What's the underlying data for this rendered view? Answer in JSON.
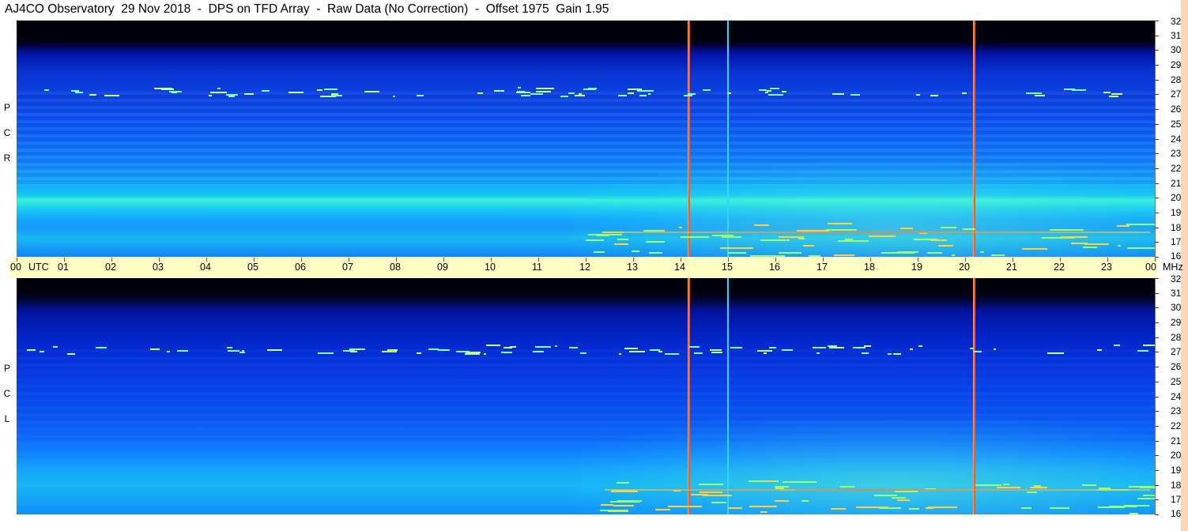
{
  "title": "AJ4CO Observatory  29 Nov 2018  -  DPS on TFD Array  -  Raw Data (No Correction)  -  Offset 1975  Gain 1.95",
  "panels": [
    {
      "id": "rcp",
      "label_letters": [
        "P",
        "C",
        "R"
      ]
    },
    {
      "id": "lcp",
      "label_letters": [
        "P",
        "C",
        "L"
      ]
    }
  ],
  "chart_data": {
    "type": "heatmap",
    "title": "AJ4CO Observatory  29 Nov 2018  -  DPS on TFD Array  -  Raw Data (No Correction)  -  Offset 1975  Gain 1.95",
    "x_axis": {
      "unit_label": "UTC",
      "tick_labels": [
        "00",
        "01",
        "02",
        "03",
        "04",
        "05",
        "06",
        "07",
        "08",
        "09",
        "10",
        "11",
        "12",
        "13",
        "14",
        "15",
        "16",
        "17",
        "18",
        "19",
        "20",
        "21",
        "22",
        "23",
        "00"
      ],
      "range_hours": [
        0,
        24
      ]
    },
    "y_axis": {
      "unit_label": "MHz",
      "ticks": [
        32,
        31,
        30,
        29,
        28,
        27,
        26,
        25,
        24,
        23,
        22,
        21,
        20,
        19,
        18,
        17,
        16
      ],
      "range_mhz": [
        16,
        32
      ]
    },
    "series": [
      {
        "name": "R C P",
        "polarization": "RCP"
      },
      {
        "name": "L C P",
        "polarization": "LCP"
      }
    ],
    "vertical_features_utc_hours": [
      {
        "time": 14.17,
        "kind": "red-line"
      },
      {
        "time": 15.0,
        "kind": "cyan-line"
      },
      {
        "time": 20.18,
        "kind": "red-line"
      }
    ],
    "colors": {
      "colormap": "jet",
      "low": "#000010",
      "mid": "#0b3fe0",
      "high": "#3ef0d8",
      "hot": "#ff3838"
    }
  }
}
